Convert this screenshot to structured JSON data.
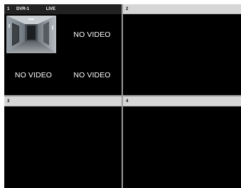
{
  "panes": [
    {
      "number": "1",
      "source": "DVR-1",
      "status": "LIVE",
      "sub_channels": [
        {
          "label": "",
          "has_video": true,
          "icon": "hallway-camera-feed"
        },
        {
          "label": "NO VIDEO",
          "has_video": false
        },
        {
          "label": "NO VIDEO",
          "has_video": false
        },
        {
          "label": "NO VIDEO",
          "has_video": false
        }
      ]
    },
    {
      "number": "2"
    },
    {
      "number": "3"
    },
    {
      "number": "4"
    }
  ],
  "colors": {
    "active_header": "#222222",
    "idle_header": "#d6d6d6",
    "divider": "#9a9a9a",
    "video_bg": "#000000",
    "overlay_text": "#ffffff"
  }
}
